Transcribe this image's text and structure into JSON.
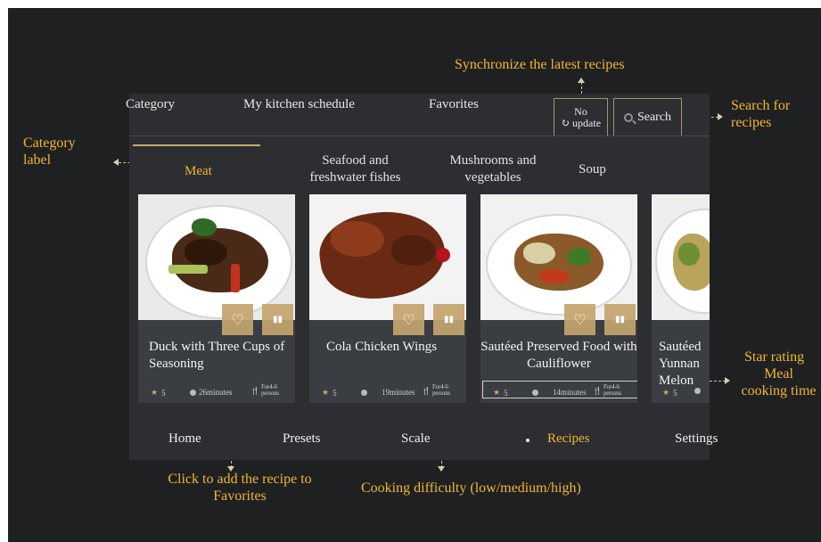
{
  "top_tabs": [
    "Category",
    "My kitchen schedule",
    "Favorites"
  ],
  "sync_button": {
    "line1": "No",
    "line2": "update",
    "icon": "refresh-icon"
  },
  "search_button": {
    "label": "Search",
    "icon": "search-icon"
  },
  "categories": [
    "Meat",
    "Seafood and freshwater fishes",
    "Mushrooms and vegetables",
    "Soup"
  ],
  "active_category": "Meat",
  "recipes": [
    {
      "title": "Duck    with Three Cups of Seasoning",
      "rating": "5",
      "time": "26minutes",
      "persons": "For4-6 persons"
    },
    {
      "title": "Cola Chicken Wings",
      "rating": "5",
      "time": "19minutes",
      "persons": "For4-6 persons"
    },
    {
      "title": "Sautéed Preserved Food with Cauliflower",
      "rating": "5",
      "time": "14minutes",
      "persons": "For4-6 persons"
    },
    {
      "title": "Sautéed Yunnan Melon",
      "rating": "5",
      "time": "",
      "persons": ""
    }
  ],
  "bottom_nav": [
    "Home",
    "Presets",
    "Scale",
    "Recipes",
    "Settings"
  ],
  "active_nav": "Recipes",
  "annotations": {
    "sync": "Synchronize the latest recipes",
    "search_line1": "Search for",
    "search_line2": "recipes",
    "category_line1": "Category",
    "category_line2": "label",
    "favorites_line1": "Click to add the recipe to",
    "favorites_line2": "Favorites",
    "difficulty": "Cooking difficulty (low/medium/high)",
    "star_rating": "Star rating",
    "meal_line1": "Meal",
    "meal_line2": "cooking time"
  },
  "colors": {
    "accent": "#f2b632",
    "gold_button": "#c3a46e",
    "device_bg": "#2c2e31",
    "canvas_bg": "#1f2022"
  }
}
